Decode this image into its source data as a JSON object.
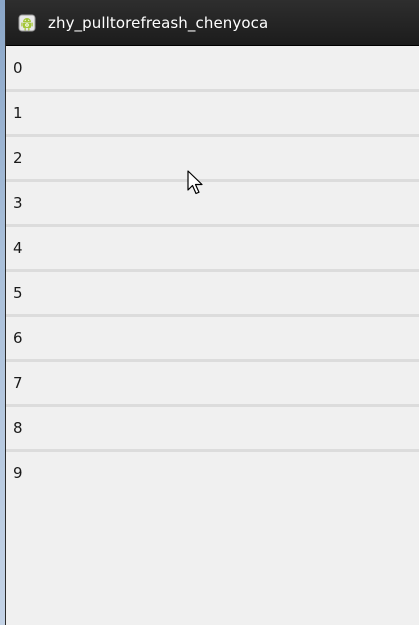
{
  "action_bar": {
    "title": "zhy_pulltorefreash_chenyoca",
    "icon": "android-robot-icon"
  },
  "list": {
    "items": [
      "0",
      "1",
      "2",
      "3",
      "4",
      "5",
      "6",
      "7",
      "8",
      "9"
    ]
  },
  "colors": {
    "action_bar_bg": "#1c1c1c",
    "list_bg": "#f0f0f0",
    "divider": "#dcdcdc",
    "android_green": "#a4c639"
  }
}
